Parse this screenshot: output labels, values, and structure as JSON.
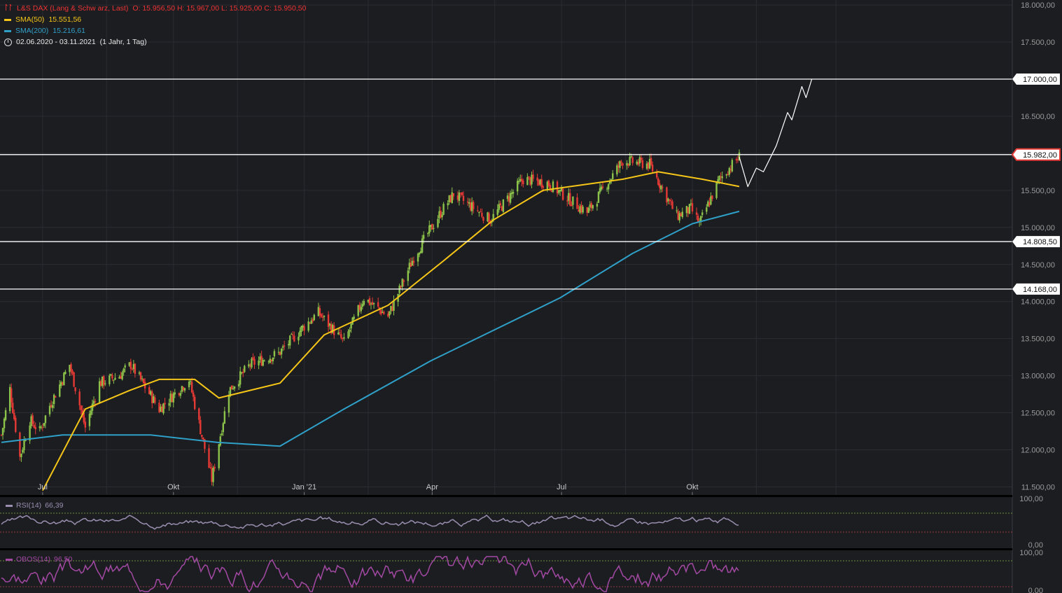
{
  "header": {
    "instrument": "L&S DAX (Lang & Schw arz, Last)",
    "ohlc": "O: 15.956,50  H: 15.967,00  L: 15.925,00  C: 15.950,50",
    "sma50_label": "SMA(50)",
    "sma50_value": "15.551,56",
    "sma200_label": "SMA(200)",
    "sma200_value": "15.216,61",
    "range_label": "02.06.2020 - 03.11.2021",
    "interval_label": "(1 Jahr, 1 Tag)"
  },
  "rsi_panel": {
    "label": "RSI(14)",
    "value": "66,39",
    "axis": [
      "100,00",
      "0,00"
    ]
  },
  "obos_panel": {
    "label": "OBOS(14)",
    "value": "96,50",
    "axis": [
      "100,00",
      "0,00"
    ]
  },
  "colors": {
    "background": "#1c1d21",
    "up": "#8bc34a",
    "down": "#e53935",
    "sma50": "#f5c518",
    "sma200": "#2fa0c8",
    "rsi": "#9a8fb0",
    "obos": "#a349a4",
    "level_line": "#ffffff"
  },
  "chart_data": {
    "type": "candlestick",
    "x_ticks": [
      "Jul",
      "Okt",
      "Jan '21",
      "Apr",
      "Jul",
      "Okt"
    ],
    "y_ticks": [
      "18.000,00",
      "17.500,00",
      "17.000,00",
      "16.500,00",
      "16.000,00",
      "15.500,00",
      "15.000,00",
      "14.500,00",
      "14.000,00",
      "13.500,00",
      "13.000,00",
      "12.500,00",
      "12.000,00",
      "11.500,00"
    ],
    "ylim": [
      11350,
      18000
    ],
    "price_levels": [
      {
        "value": 17000,
        "label": "17.000,00"
      },
      {
        "value": 15982,
        "label": "15.982,00",
        "highlight": true
      },
      {
        "value": 14808.5,
        "label": "14.808,50"
      },
      {
        "value": 14168,
        "label": "14.168,00"
      }
    ],
    "close_path": [
      {
        "date": "2020-06-02",
        "close": 12200
      },
      {
        "date": "2020-06-08",
        "close": 12820
      },
      {
        "date": "2020-06-15",
        "close": 11900
      },
      {
        "date": "2020-06-22",
        "close": 12400
      },
      {
        "date": "2020-06-29",
        "close": 12250
      },
      {
        "date": "2020-07-06",
        "close": 12600
      },
      {
        "date": "2020-07-20",
        "close": 13150
      },
      {
        "date": "2020-07-31",
        "close": 12300
      },
      {
        "date": "2020-08-10",
        "close": 12900
      },
      {
        "date": "2020-08-24",
        "close": 13000
      },
      {
        "date": "2020-09-01",
        "close": 13150
      },
      {
        "date": "2020-09-21",
        "close": 12550
      },
      {
        "date": "2020-10-12",
        "close": 12950
      },
      {
        "date": "2020-10-28",
        "close": 11600
      },
      {
        "date": "2020-11-09",
        "close": 12800
      },
      {
        "date": "2020-11-24",
        "close": 13150
      },
      {
        "date": "2020-12-14",
        "close": 13300
      },
      {
        "date": "2020-12-31",
        "close": 13650
      },
      {
        "date": "2021-01-11",
        "close": 13850
      },
      {
        "date": "2021-01-29",
        "close": 13450
      },
      {
        "date": "2021-02-12",
        "close": 14050
      },
      {
        "date": "2021-03-01",
        "close": 13800
      },
      {
        "date": "2021-03-19",
        "close": 14600
      },
      {
        "date": "2021-04-07",
        "close": 15200
      },
      {
        "date": "2021-04-16",
        "close": 15450
      },
      {
        "date": "2021-05-12",
        "close": 15100
      },
      {
        "date": "2021-06-04",
        "close": 15650
      },
      {
        "date": "2021-06-21",
        "close": 15600
      },
      {
        "date": "2021-07-19",
        "close": 15200
      },
      {
        "date": "2021-08-13",
        "close": 15900
      },
      {
        "date": "2021-09-01",
        "close": 15850
      },
      {
        "date": "2021-09-20",
        "close": 15150
      },
      {
        "date": "2021-09-30",
        "close": 15250
      },
      {
        "date": "2021-10-06",
        "close": 15050
      },
      {
        "date": "2021-10-20",
        "close": 15650
      },
      {
        "date": "2021-11-03",
        "close": 15950
      }
    ],
    "sma50": [
      {
        "date": "2020-07-01",
        "value": 11450
      },
      {
        "date": "2020-07-31",
        "value": 12550
      },
      {
        "date": "2020-08-31",
        "value": 12800
      },
      {
        "date": "2020-09-21",
        "value": 12950
      },
      {
        "date": "2020-10-16",
        "value": 12950
      },
      {
        "date": "2020-11-02",
        "value": 12700
      },
      {
        "date": "2020-12-15",
        "value": 12900
      },
      {
        "date": "2021-01-15",
        "value": 13550
      },
      {
        "date": "2021-03-01",
        "value": 13950
      },
      {
        "date": "2021-04-09",
        "value": 14550
      },
      {
        "date": "2021-05-14",
        "value": 15100
      },
      {
        "date": "2021-06-18",
        "value": 15500
      },
      {
        "date": "2021-08-13",
        "value": 15650
      },
      {
        "date": "2021-09-07",
        "value": 15750
      },
      {
        "date": "2021-10-08",
        "value": 15650
      },
      {
        "date": "2021-11-03",
        "value": 15551.56
      }
    ],
    "sma200": [
      {
        "date": "2020-06-02",
        "value": 12100
      },
      {
        "date": "2020-07-15",
        "value": 12200
      },
      {
        "date": "2020-09-15",
        "value": 12200
      },
      {
        "date": "2020-11-01",
        "value": 12100
      },
      {
        "date": "2020-12-15",
        "value": 12050
      },
      {
        "date": "2021-01-29",
        "value": 12550
      },
      {
        "date": "2021-03-31",
        "value": 13200
      },
      {
        "date": "2021-06-30",
        "value": 14050
      },
      {
        "date": "2021-08-20",
        "value": 14650
      },
      {
        "date": "2021-10-01",
        "value": 15050
      },
      {
        "date": "2021-11-03",
        "value": 15216.61
      }
    ],
    "projection": [
      {
        "date": "2021-11-03",
        "value": 15950
      },
      {
        "date": "2021-11-09",
        "value": 15550
      },
      {
        "date": "2021-11-15",
        "value": 15800
      },
      {
        "date": "2021-11-20",
        "value": 15750
      },
      {
        "date": "2021-11-29",
        "value": 16100
      },
      {
        "date": "2021-12-07",
        "value": 16550
      },
      {
        "date": "2021-12-10",
        "value": 16450
      },
      {
        "date": "2021-12-17",
        "value": 16900
      },
      {
        "date": "2021-12-20",
        "value": 16750
      },
      {
        "date": "2021-12-24",
        "value": 17000
      }
    ]
  }
}
